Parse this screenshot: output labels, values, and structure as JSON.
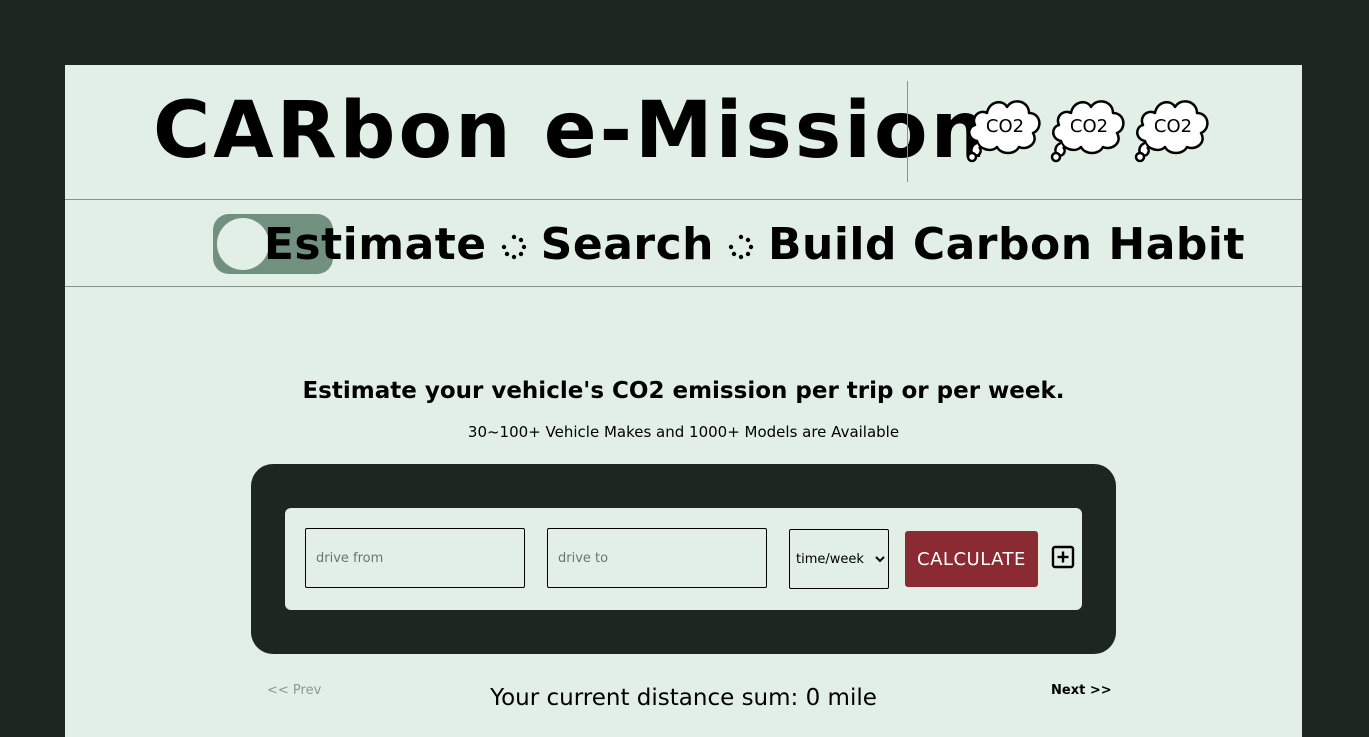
{
  "header": {
    "title": "CARbon e-Mission",
    "co2_icons": [
      "CO2",
      "CO2",
      "CO2"
    ]
  },
  "nav": {
    "toggle_state": "off",
    "items": [
      {
        "label": "Estimate"
      },
      {
        "label": "Search"
      },
      {
        "label": "Build Carbon Habit"
      }
    ],
    "separator_icon": "dotted-spinner-icon"
  },
  "main": {
    "headline": "Estimate your vehicle's CO2 emission per trip or per week.",
    "subheadline": "30~100+ Vehicle Makes and 1000+ Models are Available"
  },
  "form": {
    "from_placeholder": "drive from",
    "to_placeholder": "drive to",
    "frequency_selected": "time/week",
    "calculate_label": "CALCULATE",
    "add_icon": "plus-square-icon"
  },
  "footer": {
    "prev_label": "<< Prev",
    "next_label": "Next >>",
    "distance_text": "Your current distance sum: 0 mile"
  },
  "colors": {
    "background": "#1e2622",
    "page": "#e2efe6",
    "toggle": "#729080",
    "accent": "#8b2a33"
  }
}
